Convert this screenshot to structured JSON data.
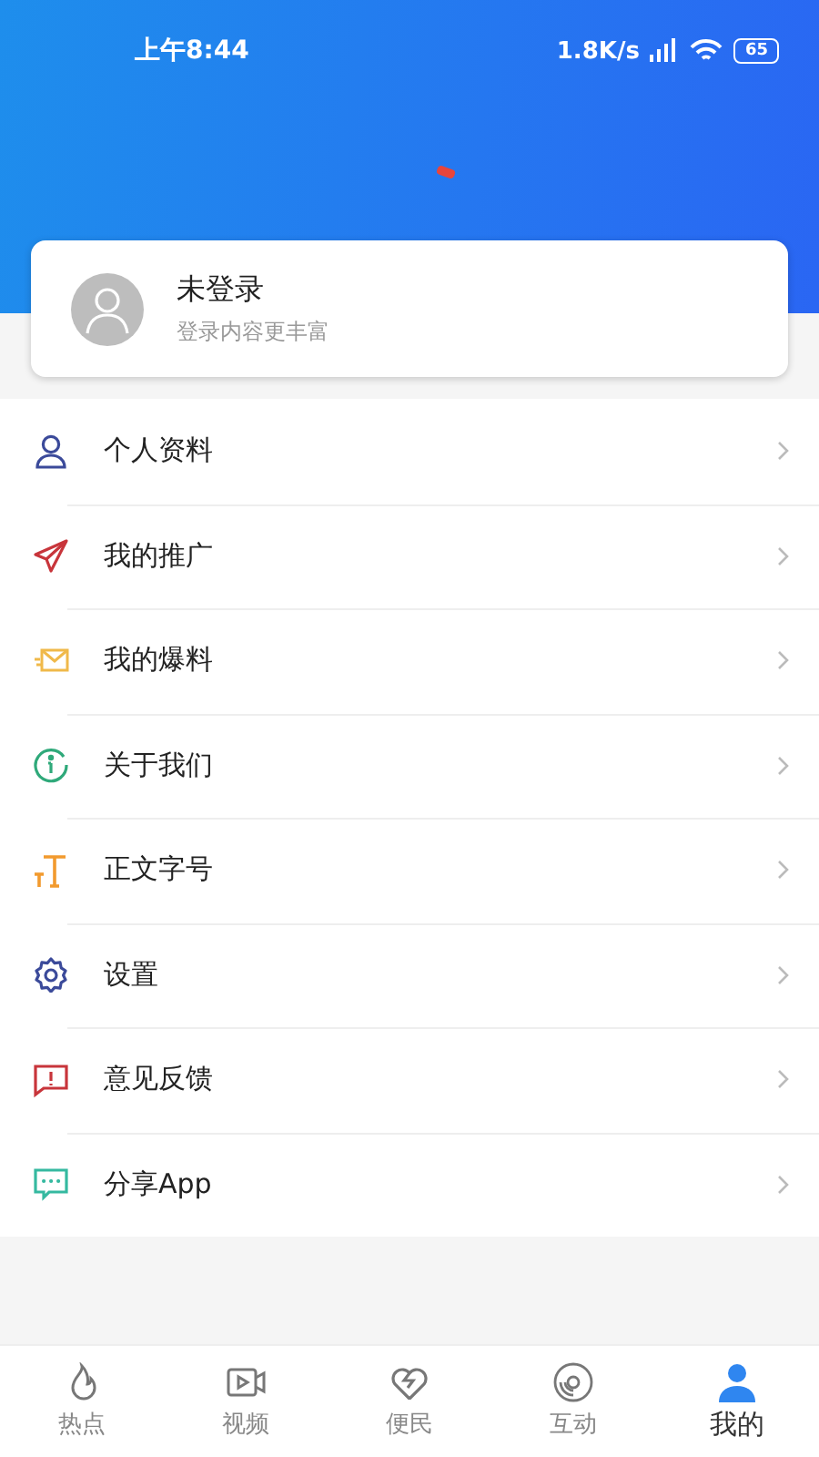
{
  "status_bar": {
    "time": "上午8:44",
    "speed": "1.8K/s",
    "battery": "65"
  },
  "profile": {
    "name": "未登录",
    "subtitle": "登录内容更丰富"
  },
  "menu": [
    {
      "kind": "person",
      "label": "个人资料"
    },
    {
      "kind": "plane",
      "label": "我的推广"
    },
    {
      "kind": "mail",
      "label": "我的爆料"
    },
    {
      "kind": "info",
      "label": "关于我们"
    },
    {
      "kind": "font",
      "label": "正文字号"
    },
    {
      "kind": "gear",
      "label": "设置"
    },
    {
      "kind": "alert",
      "label": "意见反馈"
    },
    {
      "kind": "chat",
      "label": "分享App"
    }
  ],
  "tabs": [
    {
      "kind": "flame",
      "label": "热点",
      "selected": false
    },
    {
      "kind": "video",
      "label": "视频",
      "selected": false
    },
    {
      "kind": "heart",
      "label": "便民",
      "selected": false
    },
    {
      "kind": "disc",
      "label": "互动",
      "selected": false
    },
    {
      "kind": "user",
      "label": "我的",
      "selected": true
    }
  ]
}
